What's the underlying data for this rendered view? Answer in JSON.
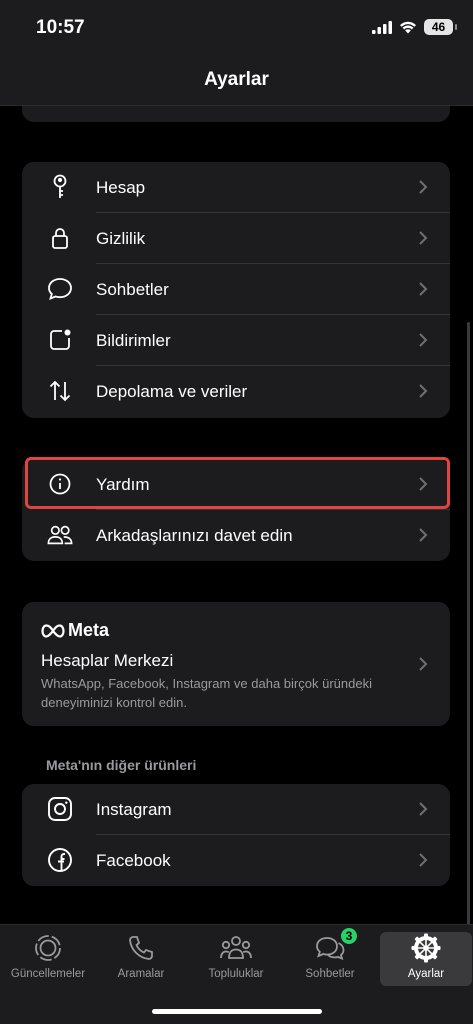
{
  "status": {
    "time": "10:57",
    "battery": "46"
  },
  "header": {
    "title": "Ayarlar"
  },
  "settings_group": [
    {
      "label": "Hesap",
      "icon": "key-icon"
    },
    {
      "label": "Gizlilik",
      "icon": "lock-icon"
    },
    {
      "label": "Sohbetler",
      "icon": "chat-bubble-icon"
    },
    {
      "label": "Bildirimler",
      "icon": "notification-icon"
    },
    {
      "label": "Depolama ve veriler",
      "icon": "storage-arrows-icon"
    }
  ],
  "help_group": [
    {
      "label": "Yardım",
      "icon": "info-icon",
      "highlighted": true
    },
    {
      "label": "Arkadaşlarınızı davet edin",
      "icon": "people-icon"
    }
  ],
  "meta": {
    "logo_text": "Meta",
    "title": "Hesaplar Merkezi",
    "description": "WhatsApp, Facebook, Instagram ve daha birçok üründeki deneyiminizi kontrol edin."
  },
  "other_products": {
    "header": "Meta'nın diğer ürünleri",
    "items": [
      {
        "label": "Instagram",
        "icon": "instagram-icon"
      },
      {
        "label": "Facebook",
        "icon": "facebook-icon"
      }
    ]
  },
  "tabs": [
    {
      "label": "Güncellemeler",
      "icon": "updates-icon"
    },
    {
      "label": "Aramalar",
      "icon": "phone-icon"
    },
    {
      "label": "Topluluklar",
      "icon": "communities-icon"
    },
    {
      "label": "Sohbetler",
      "icon": "chats-icon",
      "badge": "3"
    },
    {
      "label": "Ayarlar",
      "icon": "settings-icon",
      "active": true
    }
  ],
  "colors": {
    "highlight": "#e0463f",
    "badge": "#25d366",
    "card": "#1c1c1e"
  }
}
